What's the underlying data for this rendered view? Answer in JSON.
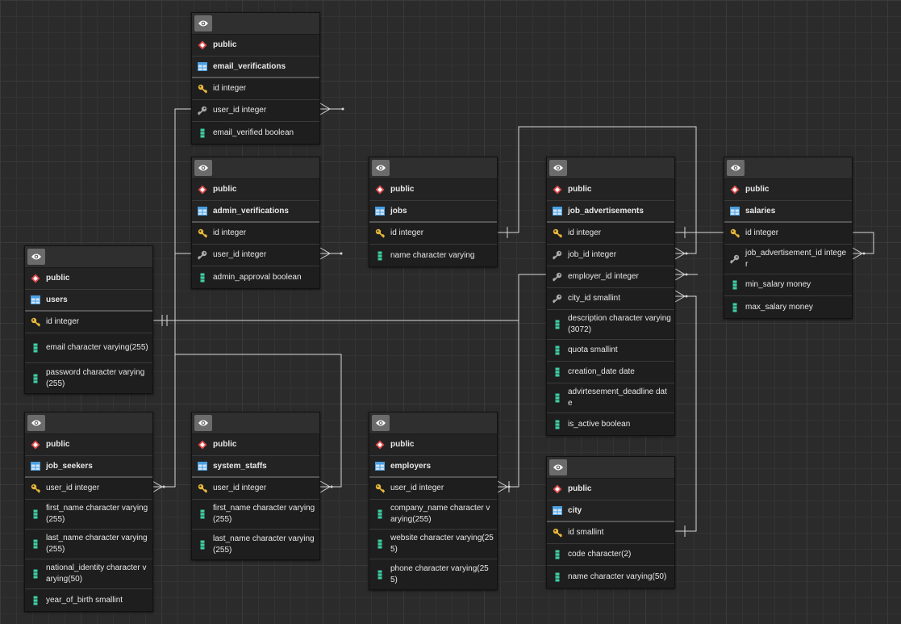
{
  "tables": [
    {
      "id": "email_verifications",
      "schema": "public",
      "name": "email_verifications",
      "columns": [
        {
          "text": "id integer",
          "icon": "primary-key-icon"
        },
        {
          "text": "user_id integer",
          "icon": "foreign-key-icon"
        },
        {
          "text": "email_verified boolean",
          "icon": "column-icon"
        }
      ]
    },
    {
      "id": "admin_verifications",
      "schema": "public",
      "name": "admin_verifications",
      "columns": [
        {
          "text": "id integer",
          "icon": "primary-key-icon"
        },
        {
          "text": "user_id integer",
          "icon": "foreign-key-icon"
        },
        {
          "text": "admin_approval boolean",
          "icon": "column-icon"
        }
      ]
    },
    {
      "id": "jobs",
      "schema": "public",
      "name": "jobs",
      "columns": [
        {
          "text": "id integer",
          "icon": "primary-key-icon"
        },
        {
          "text": "name character varying",
          "icon": "column-icon"
        }
      ]
    },
    {
      "id": "job_advertisements",
      "schema": "public",
      "name": "job_advertisements",
      "columns": [
        {
          "text": "id integer",
          "icon": "primary-key-icon"
        },
        {
          "text": "job_id integer",
          "icon": "foreign-key-icon"
        },
        {
          "text": "employer_id integer",
          "icon": "foreign-key-icon"
        },
        {
          "text": "city_id smallint",
          "icon": "foreign-key-icon"
        },
        {
          "text": "description character varying(3072)",
          "icon": "column-icon"
        },
        {
          "text": "quota smallint",
          "icon": "column-icon"
        },
        {
          "text": "creation_date date",
          "icon": "column-icon"
        },
        {
          "text": "advirtesement_deadline date",
          "icon": "column-icon"
        },
        {
          "text": "is_active boolean",
          "icon": "column-icon"
        }
      ]
    },
    {
      "id": "salaries",
      "schema": "public",
      "name": "salaries",
      "columns": [
        {
          "text": "id integer",
          "icon": "primary-key-icon"
        },
        {
          "text": "job_advertisement_id integer",
          "icon": "foreign-key-icon"
        },
        {
          "text": "min_salary money",
          "icon": "column-icon"
        },
        {
          "text": "max_salary money",
          "icon": "column-icon"
        }
      ]
    },
    {
      "id": "users",
      "schema": "public",
      "name": "users",
      "columns": [
        {
          "text": "id integer",
          "icon": "primary-key-icon"
        },
        {
          "text": "email character varying(255)",
          "icon": "column-icon"
        },
        {
          "text": "password character varying(255)",
          "icon": "column-icon"
        }
      ]
    },
    {
      "id": "job_seekers",
      "schema": "public",
      "name": "job_seekers",
      "columns": [
        {
          "text": "user_id integer",
          "icon": "primary-key-icon"
        },
        {
          "text": "first_name character varying(255)",
          "icon": "column-icon"
        },
        {
          "text": "last_name character varying(255)",
          "icon": "column-icon"
        },
        {
          "text": "national_identity character varying(50)",
          "icon": "column-icon"
        },
        {
          "text": "year_of_birth smallint",
          "icon": "column-icon"
        }
      ]
    },
    {
      "id": "system_staffs",
      "schema": "public",
      "name": "system_staffs",
      "columns": [
        {
          "text": "user_id integer",
          "icon": "primary-key-icon"
        },
        {
          "text": "first_name character varying(255)",
          "icon": "column-icon"
        },
        {
          "text": "last_name character varying(255)",
          "icon": "column-icon"
        }
      ]
    },
    {
      "id": "employers",
      "schema": "public",
      "name": "employers",
      "columns": [
        {
          "text": "user_id integer",
          "icon": "primary-key-icon"
        },
        {
          "text": "company_name character varying(255)",
          "icon": "column-icon"
        },
        {
          "text": "website character varying(255)",
          "icon": "column-icon"
        },
        {
          "text": "phone character varying(255)",
          "icon": "column-icon"
        }
      ]
    },
    {
      "id": "city",
      "schema": "public",
      "name": "city",
      "columns": [
        {
          "text": "id smallint",
          "icon": "primary-key-icon"
        },
        {
          "text": "code character(2)",
          "icon": "column-icon"
        },
        {
          "text": "name character varying(50)",
          "icon": "column-icon"
        }
      ]
    }
  ],
  "relationships": [
    {
      "from": "email_verifications.user_id",
      "to": "users.id"
    },
    {
      "from": "admin_verifications.user_id",
      "to": "users.id"
    },
    {
      "from": "job_seekers.user_id",
      "to": "users.id"
    },
    {
      "from": "system_staffs.user_id",
      "to": "users.id"
    },
    {
      "from": "job_advertisements.job_id",
      "to": "jobs.id"
    },
    {
      "from": "job_advertisements.employer_id",
      "to": "employers.user_id"
    },
    {
      "from": "job_advertisements.city_id",
      "to": "city.id"
    },
    {
      "from": "salaries.job_advertisement_id",
      "to": "job_advertisements.id"
    },
    {
      "from": "employers.user_id",
      "to": "users.id"
    }
  ],
  "colors": {
    "background": "#2b2b2b",
    "table_body": "#1e1e1e",
    "line": "#d8d8d8",
    "pk_key": "#e8b83a",
    "fk_key": "#aaaaaa",
    "column_icon": "#3fcfa4",
    "schema_icon": "#e04848",
    "table_icon": "#4a9fe0"
  }
}
